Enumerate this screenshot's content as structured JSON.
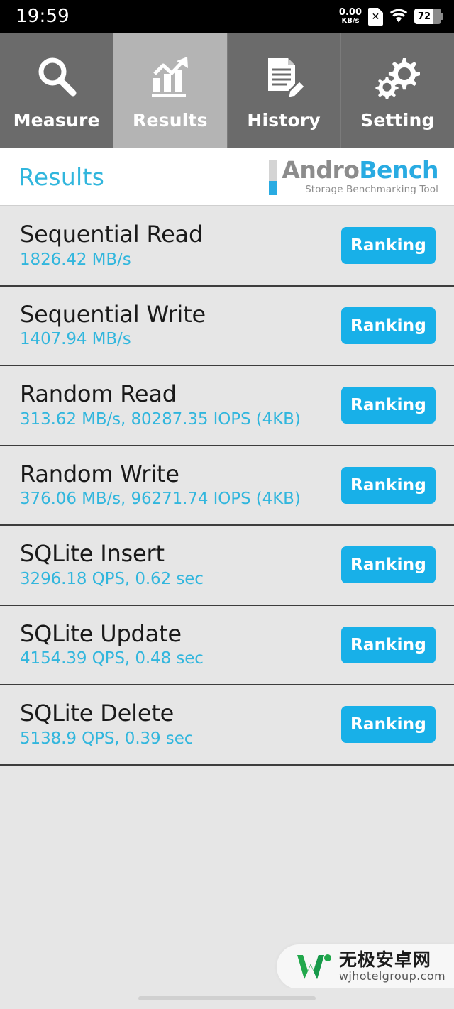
{
  "status_bar": {
    "time": "19:59",
    "net_speed_value": "0.00",
    "net_speed_unit": "KB/s",
    "sim_icon": "sim-card-disabled-icon",
    "sim_mark": "✕",
    "wifi_icon": "wifi-icon",
    "battery_percent": "72",
    "battery_level": 72
  },
  "tabs": [
    {
      "label": "Measure",
      "icon": "magnifier-icon",
      "active": false
    },
    {
      "label": "Results",
      "icon": "bar-chart-arrow-icon",
      "active": true
    },
    {
      "label": "History",
      "icon": "document-pencil-icon",
      "active": false
    },
    {
      "label": "Setting",
      "icon": "gears-icon",
      "active": false
    }
  ],
  "header": {
    "title": "Results",
    "logo_primary": "Andro",
    "logo_secondary": "Bench",
    "logo_subtitle": "Storage Benchmarking Tool"
  },
  "results": [
    {
      "title": "Sequential Read",
      "value": "1826.42 MB/s",
      "button": "Ranking"
    },
    {
      "title": "Sequential Write",
      "value": "1407.94 MB/s",
      "button": "Ranking"
    },
    {
      "title": "Random Read",
      "value": "313.62 MB/s, 80287.35 IOPS (4KB)",
      "button": "Ranking"
    },
    {
      "title": "Random Write",
      "value": "376.06 MB/s, 96271.74 IOPS (4KB)",
      "button": "Ranking"
    },
    {
      "title": "SQLite Insert",
      "value": "3296.18 QPS, 0.62 sec",
      "button": "Ranking"
    },
    {
      "title": "SQLite Update",
      "value": "4154.39 QPS, 0.48 sec",
      "button": "Ranking"
    },
    {
      "title": "SQLite Delete",
      "value": "5138.9 QPS, 0.39 sec",
      "button": "Ranking"
    }
  ],
  "watermark": {
    "site_name": "无极安卓网",
    "url": "wjhotelgroup.com",
    "logo_icon": "w-letter-logo-icon"
  },
  "colors": {
    "accent_cyan": "#31b6dd",
    "button_blue": "#18b0e8",
    "logo_gray": "#8c8c8c",
    "tab_inactive": "#6b6b6b",
    "tab_active": "#b4b4b4",
    "page_bg": "#e6e6e6",
    "divider": "#3d3d3d",
    "watermark_green": "#21a84b"
  }
}
